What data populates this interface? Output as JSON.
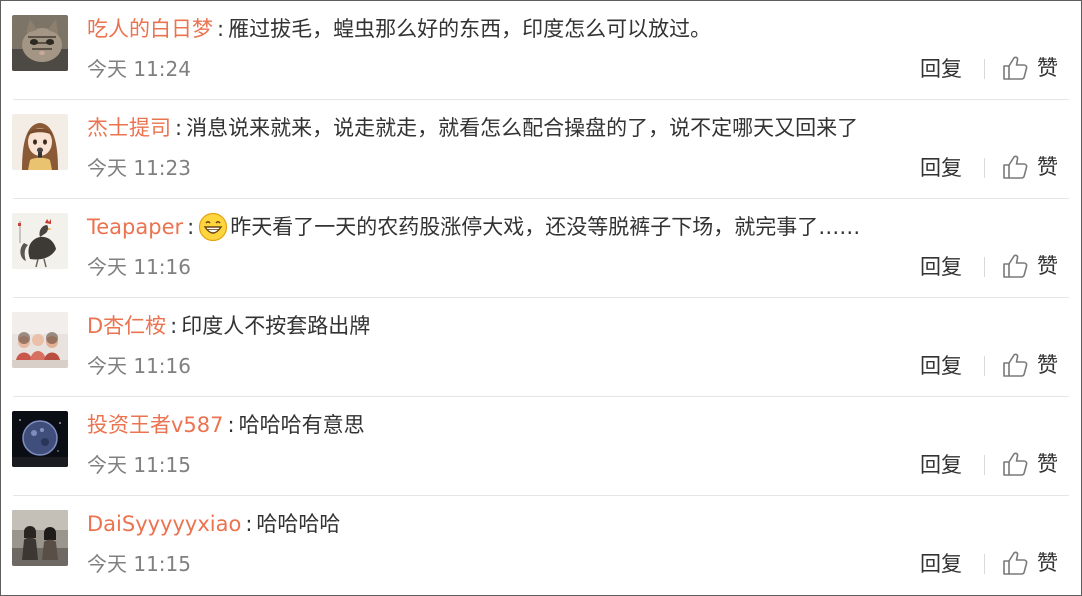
{
  "comments": [
    {
      "username": "吃人的白日梦",
      "text": "雁过拔毛，蝗虫那么好的东西，印度怎么可以放过。",
      "time": "今天 11:24",
      "avatar": "cat-avatar",
      "has_emoji": false
    },
    {
      "username": "杰士提司",
      "text": "消息说来就来，说走就走，就看怎么配合操盘的了，说不定哪天又回来了",
      "time": "今天 11:23",
      "avatar": "anime-girl-avatar",
      "has_emoji": false
    },
    {
      "username": "Teapaper",
      "text": "昨天看了一天的农药股涨停大戏，还没等脱裤子下场，就完事了……",
      "time": "今天 11:16",
      "avatar": "rooster-painting-avatar",
      "has_emoji": true,
      "emoji": "grinning-face-emoji"
    },
    {
      "username": "D杏仁桉",
      "text": "印度人不按套路出牌",
      "time": "今天 11:16",
      "avatar": "group-photo-avatar",
      "has_emoji": false
    },
    {
      "username": "投资王者v587",
      "text": "哈哈哈有意思",
      "time": "今天 11:15",
      "avatar": "planet-avatar",
      "has_emoji": false
    },
    {
      "username": "DaiSyyyyyxiao",
      "text": "哈哈哈哈",
      "time": "今天 11:15",
      "avatar": "street-photo-avatar",
      "has_emoji": false
    }
  ],
  "actions": {
    "reply_label": "回复",
    "like_label": "赞",
    "like_icon": "thumbs-up-icon"
  },
  "colors": {
    "username": "#eb7350",
    "text": "#333333",
    "time": "#808080",
    "divider": "#e6e6e6",
    "border": "#5e5e5e"
  }
}
